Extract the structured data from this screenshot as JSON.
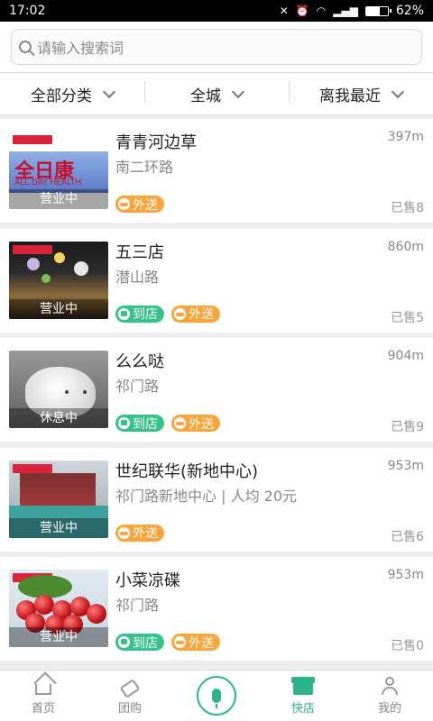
{
  "status_bar": {
    "time": "17:02",
    "battery": "62%",
    "battery_level": 0.62
  },
  "search": {
    "placeholder": "请输入搜索词"
  },
  "filters": [
    {
      "label": "全部分类"
    },
    {
      "label": "全城"
    },
    {
      "label": "离我最近"
    }
  ],
  "thumb_texts": {
    "brand": "全日康",
    "brand_en": "ALL DAY HEALTH"
  },
  "stores": [
    {
      "name": "青青河边草",
      "address": "南二环路",
      "distance": "397m",
      "sold": "已售8",
      "status": "营业中",
      "tags": [
        "外送"
      ]
    },
    {
      "name": "五三店",
      "address": "潜山路",
      "distance": "860m",
      "sold": "已售5",
      "status": "营业中",
      "tags": [
        "到店",
        "外送"
      ]
    },
    {
      "name": "么么哒",
      "address": "祁门路",
      "distance": "904m",
      "sold": "已售9",
      "status": "休息中",
      "tags": [
        "到店",
        "外送"
      ]
    },
    {
      "name": "世纪联华(新地中心)",
      "address": "祁门路新地中心 | 人均 20元",
      "distance": "953m",
      "sold": "已售6",
      "status": "营业中",
      "tags": [
        "外送"
      ]
    },
    {
      "name": "小菜凉碟",
      "address": "祁门路",
      "distance": "953m",
      "sold": "已售0",
      "status": "营业中",
      "tags": [
        "到店",
        "外送"
      ]
    }
  ],
  "tabbar": [
    {
      "label": "首页"
    },
    {
      "label": "团购"
    },
    {
      "label": "快店"
    },
    {
      "label": "我的"
    }
  ],
  "colors": {
    "accent": "#2bb38a",
    "store_tag": "#35c38a",
    "delivery_tag": "#f9a53a"
  }
}
